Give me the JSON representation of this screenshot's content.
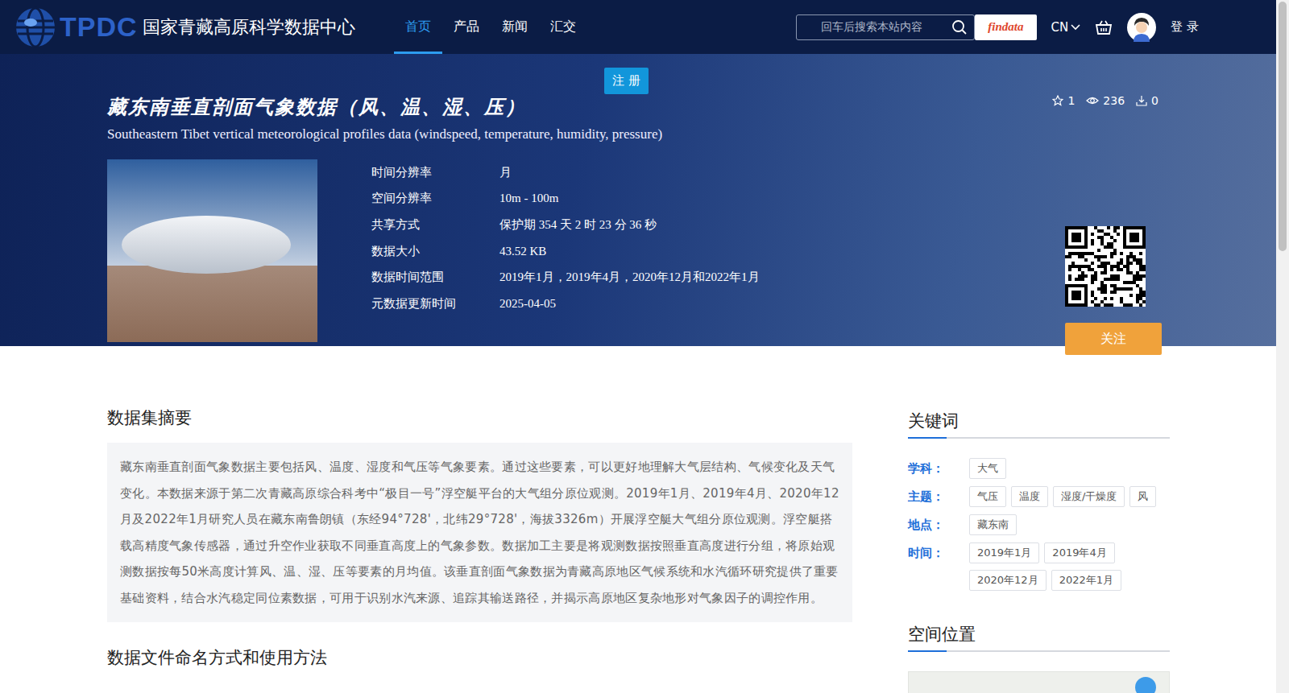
{
  "header": {
    "logo": {
      "abbr": "TPDC",
      "name": "国家青藏高原科学数据中心"
    },
    "nav": [
      {
        "label": "首页",
        "selected": true
      },
      {
        "label": "产品",
        "selected": false
      },
      {
        "label": "新闻",
        "selected": false
      },
      {
        "label": "汇交",
        "selected": false
      }
    ],
    "search": {
      "placeholder": "回车后搜索本站内容"
    },
    "findata": "findata",
    "language": "CN",
    "login": "登 录"
  },
  "register": "注 册",
  "dataset": {
    "title": "藏东南垂直剖面气象数据（风、温、湿、压）",
    "subtitle": "Southeastern Tibet vertical meteorological profiles data (windspeed, temperature, humidity, pressure)",
    "stats": [
      {
        "kind": "star",
        "count": "1"
      },
      {
        "kind": "eye",
        "count": "236"
      },
      {
        "kind": "download",
        "count": "0"
      }
    ]
  },
  "info": [
    {
      "label": "时间分辨率",
      "value": "月"
    },
    {
      "label": "空间分辨率",
      "value": "10m - 100m"
    },
    {
      "label": "共享方式",
      "value": "保护期 354 天 2 时 23 分 36 秒"
    },
    {
      "label": "数据大小",
      "value": "43.52 KB"
    },
    {
      "label": "数据时间范围",
      "value": "2019年1月，2019年4月，2020年12月和2022年1月"
    },
    {
      "label": "元数据更新时间",
      "value": "2025-04-05"
    }
  ],
  "follow": "关注",
  "abstract": {
    "heading": "数据集摘要",
    "text": "藏东南垂直剖面气象数据主要包括风、温度、湿度和气压等气象要素。通过这些要素，可以更好地理解大气层结构、气候变化及天气变化。本数据来源于第二次青藏高原综合科考中“极目一号”浮空艇平台的大气组分原位观测。2019年1月、2019年4月、2020年12月及2022年1月研究人员在藏东南鲁朗镇（东经94°728'，北纬29°728'，海拔3326m）开展浮空艇大气组分原位观测。浮空艇搭载高精度气象传感器，通过升空作业获取不同垂直高度上的气象参数。数据加工主要是将观测数据按照垂直高度进行分组，将原始观测数据按每50米高度计算风、温、湿、压等要素的月均值。该垂直剖面气象数据为青藏高原地区气候系统和水汽循环研究提供了重要基础资料，结合水汽稳定同位素数据，可用于识别水汽来源、追踪其输送路径，并揭示高原地区复杂地形对气象因子的调控作用。"
  },
  "naming_heading": "数据文件命名方式和使用方法",
  "keywords": {
    "heading": "关键词",
    "groups": [
      {
        "label": "学科：",
        "tags": [
          "大气"
        ]
      },
      {
        "label": "主题：",
        "tags": [
          "气压",
          "温度",
          "湿度/干燥度",
          "风"
        ]
      },
      {
        "label": "地点：",
        "tags": [
          "藏东南"
        ]
      },
      {
        "label": "时间：",
        "tags": [
          "2019年1月",
          "2019年4月",
          "2020年12月",
          "2022年1月"
        ]
      }
    ]
  },
  "space_heading": "空间位置"
}
